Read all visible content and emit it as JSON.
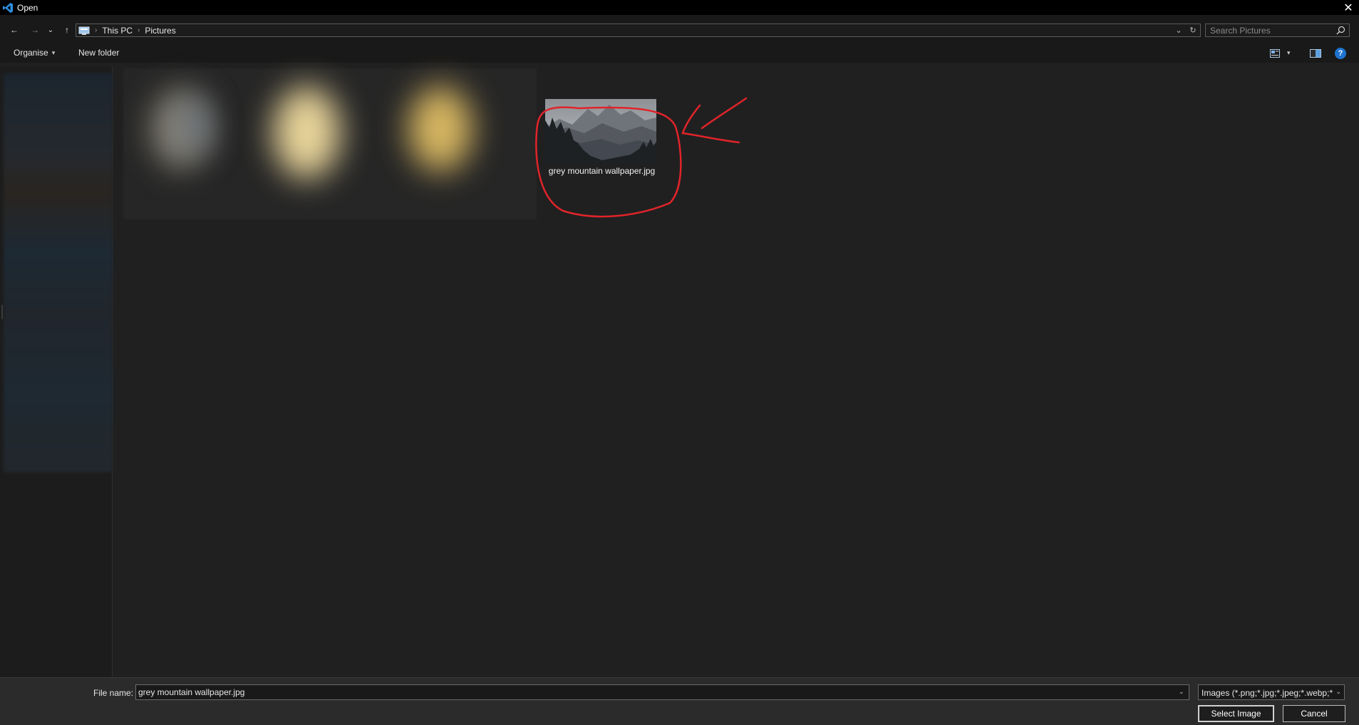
{
  "window": {
    "title": "Open",
    "close_glyph": "✕"
  },
  "nav": {
    "back_glyph": "←",
    "forward_glyph": "→",
    "recent_glyph": "⌄",
    "up_glyph": "↑",
    "breadcrumbs": [
      "This PC",
      "Pictures"
    ],
    "crumb_separator": "›",
    "dropdown_glyph": "⌄",
    "refresh_glyph": "↻",
    "search_placeholder": "Search Pictures"
  },
  "toolbar": {
    "organise_label": "Organise",
    "organise_caret": "▾",
    "new_folder_label": "New folder",
    "view_caret": "▾",
    "help_glyph": "?"
  },
  "files": {
    "selected_file_name": "grey mountain wallpaper.jpg"
  },
  "footer": {
    "file_name_label": "File name:",
    "file_name_value": "grey mountain wallpaper.jpg",
    "file_name_caret": "⌄",
    "filter_text": "Images (*.png;*.jpg;*.jpeg;*.webp;*",
    "filter_caret": "⌄",
    "select_button": "Select Image",
    "cancel_button": "Cancel"
  },
  "colors": {
    "annotation_red": "#e0242a",
    "accent_blue": "#1e73d0",
    "app_icon_blue": "#2d8ee0"
  },
  "icons": {
    "app": "vscode-icon",
    "address": "this-pc-icon",
    "search": "search-icon",
    "view": "view-options-icon",
    "pane": "preview-pane-icon",
    "help": "help-icon"
  }
}
